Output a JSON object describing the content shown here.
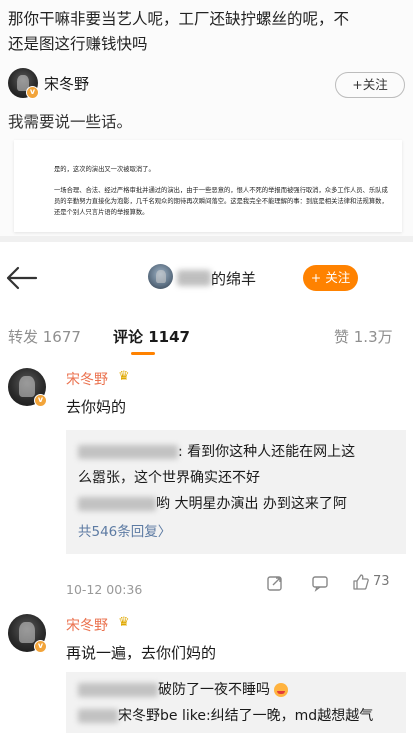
{
  "caption": {
    "line1": "那你干嘛非要当艺人呢，工厂还缺拧螺丝的呢，不",
    "line2": "还是图这行赚钱快吗"
  },
  "inner_post": {
    "author": "宋冬野",
    "follow_label": "+关注",
    "text": "我需要说一些话。",
    "statement": {
      "p1": "是的，这次的演出又一次被取消了。",
      "p2": "一场合理、合法、经过严格审批并通过的演出，由于一些恶意的，恨人不死的举报而被强行取消，众多工作人员、乐队成员的辛勤努力直接化为泡影，几千名观众的期待再次瞬间落空。这是我完全不能理解的事：到底是相关法律和法规算数，还是个别人只言片语的举报算数。"
    }
  },
  "navbar": {
    "account_name": "的绵羊",
    "follow_label": "+ 关注"
  },
  "tabs": {
    "repost": "转发 1677",
    "comment": "评论 1147",
    "like": "赞 1.3万"
  },
  "comment1": {
    "author": "宋冬野",
    "text": "去你妈的",
    "reply1_a": ": 看到你这种人还能在网上这",
    "reply1_b": "么嚣张，这个世界确实还不好",
    "reply2": "哟 大明星办演出 办到这来了阿",
    "more_replies": "共546条回复",
    "more_arrow": "〉",
    "time": "10-12 00:36",
    "likes": "73"
  },
  "comment2": {
    "author": "宋冬野",
    "text": "再说一遍，去你们妈的",
    "reply1": "破防了一夜不睡吗",
    "reply2": "宋冬野be like:纠结了一晚，md越想越气"
  },
  "colors": {
    "accent_orange": "#ff8200",
    "username": "#eb7350",
    "link": "#5d7ba3"
  },
  "icons": [
    "back-arrow-icon",
    "share-icon",
    "comment-icon",
    "like-icon",
    "crown-icon",
    "verified-badge-icon"
  ]
}
